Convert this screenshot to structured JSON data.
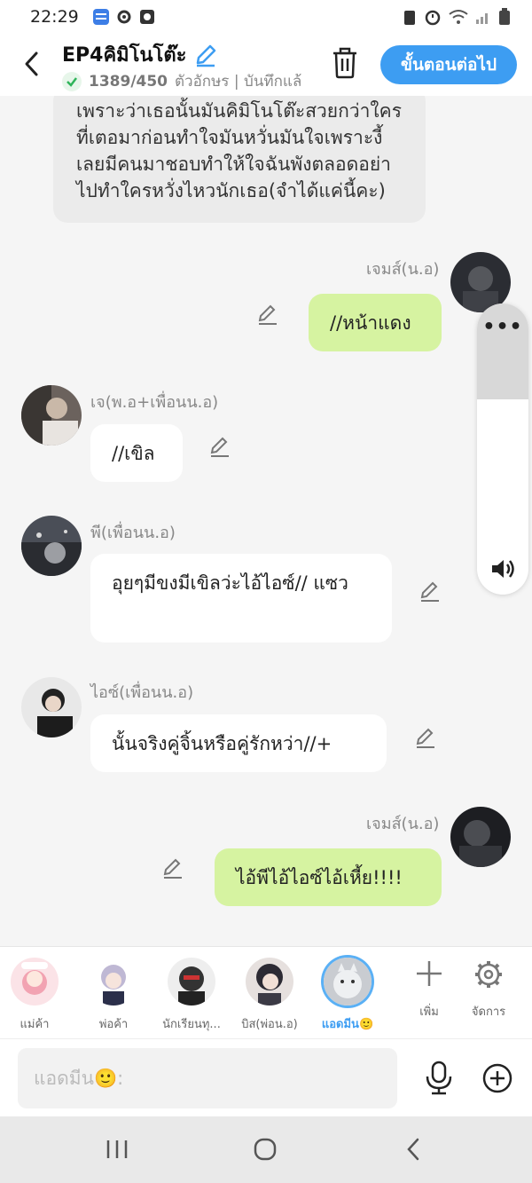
{
  "status": {
    "time": "22:29"
  },
  "header": {
    "title": "EP4คิมิโนโต๊ะ",
    "count": "1389/450",
    "count_suffix": "ตัวอักษร | บันทึกแล้",
    "next_label": "ขั้นตอนต่อไป"
  },
  "messages": [
    {
      "type": "narration",
      "text": "เพราะว่าเธอนั้นมันคิมิโนโต๊ะสวยกว่าใคร ที่เตอมาก่อนทำใจมันหวั่นมันใจเพราะงี้ เลยมีคนมาชอบทำให้ใจฉันพังตลอดอย่า ไปทำใครหวั่งไหวนักเธอ(จำได้แค่นี้คะ)"
    },
    {
      "side": "right",
      "name": "เจมส์(น.อ)",
      "text": "//หน้าแดง"
    },
    {
      "side": "left",
      "name": "เจ(พ.อ+เพื่อนน.อ)",
      "text": "//เขิล"
    },
    {
      "side": "left",
      "name": "พี(เพื่อนน.อ)",
      "text": "อุยๆมีขงมีเขิลว่ะไอ้ไอซ์// แซว"
    },
    {
      "side": "left",
      "name": "ไอซ์(เพื่อนน.อ)",
      "text": "นั้นจริงคู่จิ้นหรือคู่รักหว่า//+"
    },
    {
      "side": "right",
      "name": "เจมส์(น.อ)",
      "text": "ไอ้พีไอ้ไอซ์ไอ้เหี้ย!!!!"
    }
  ],
  "characters": [
    {
      "label": "แม่ค้า"
    },
    {
      "label": "พ่อค้า"
    },
    {
      "label": "นักเรียนทุ..."
    },
    {
      "label": "บิส(พ่อน.อ)"
    },
    {
      "label": "แอดมีน🙂"
    }
  ],
  "char_actions": {
    "add": "เพิ่ม",
    "manage": "จัดการ"
  },
  "input": {
    "placeholder": "แอดมีน🙂:"
  },
  "colors": {
    "accent": "#3d9df2",
    "bubble_green": "#d6f3a1",
    "bubble_white": "#ffffff",
    "narration_gray": "#ebebeb"
  }
}
